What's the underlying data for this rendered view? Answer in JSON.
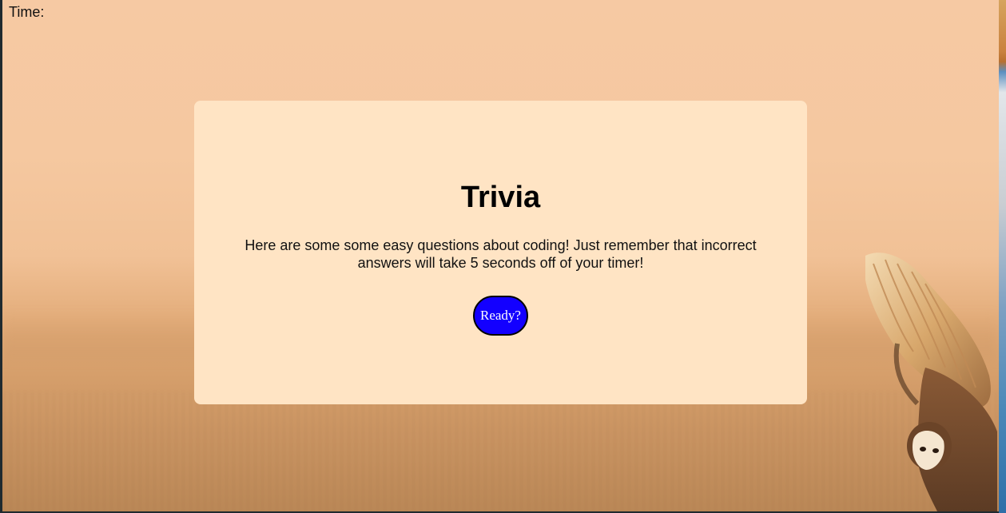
{
  "header": {
    "timer_label": "Time:"
  },
  "card": {
    "title": "Trivia",
    "intro": "Here are some some easy questions about coding! Just remember that incorrect answers will take 5 seconds off of your timer!",
    "start_button_label": "Ready?"
  },
  "colors": {
    "card_background": "#ffe4c4",
    "button_background": "#1300ff",
    "button_text": "#ffffff"
  },
  "background": {
    "image": "owl-flying-over-field"
  }
}
